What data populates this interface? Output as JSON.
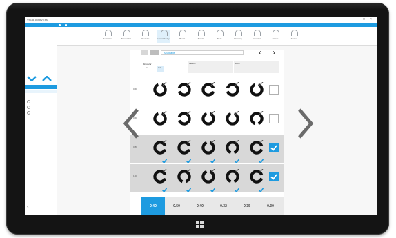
{
  "app": {
    "title": "Visual Acuity Test"
  },
  "top_nav": {
    "chevron_left": "‹",
    "chevron_right": "›",
    "field_text": "Acuidade"
  },
  "ribbon": {
    "items": [
      {
        "label": "Refraction"
      },
      {
        "label": "Monocular"
      },
      {
        "label": "Binocular"
      },
      {
        "label": "Visual Acuity"
      },
      {
        "label": "Phoria"
      },
      {
        "label": "Tropia"
      },
      {
        "label": "Near"
      },
      {
        "label": "Reading"
      },
      {
        "label": "Contrast"
      },
      {
        "label": "Stereo"
      },
      {
        "label": "Amsler"
      }
    ]
  },
  "tabs": [
    {
      "label": "Binocular",
      "sub": [
        "0.6",
        "1.0"
      ]
    },
    {
      "label": "Muscle",
      "sub": []
    },
    {
      "label": "Lens",
      "sub": []
    }
  ],
  "rows": [
    {
      "label": "0.50",
      "checked": false,
      "orientations": [
        "up",
        "left",
        "right",
        "left",
        "up"
      ]
    },
    {
      "label": "0.60",
      "checked": false,
      "orientations": [
        "up",
        "left",
        "up",
        "up",
        "down"
      ]
    },
    {
      "label": "0.80",
      "checked": true,
      "orientations": [
        "right",
        "right",
        "up",
        "down",
        "right"
      ]
    },
    {
      "label": "1.00",
      "checked": true,
      "orientations": [
        "right",
        "down",
        "up",
        "down",
        "right"
      ]
    }
  ],
  "values_bar": {
    "values": [
      "0.40",
      "0.50",
      "0.40",
      "0.32",
      "0.35",
      "0.30"
    ],
    "active_index": 0
  },
  "colors": {
    "accent": "#1e9be0",
    "grey_row": "#d8d8d8"
  }
}
